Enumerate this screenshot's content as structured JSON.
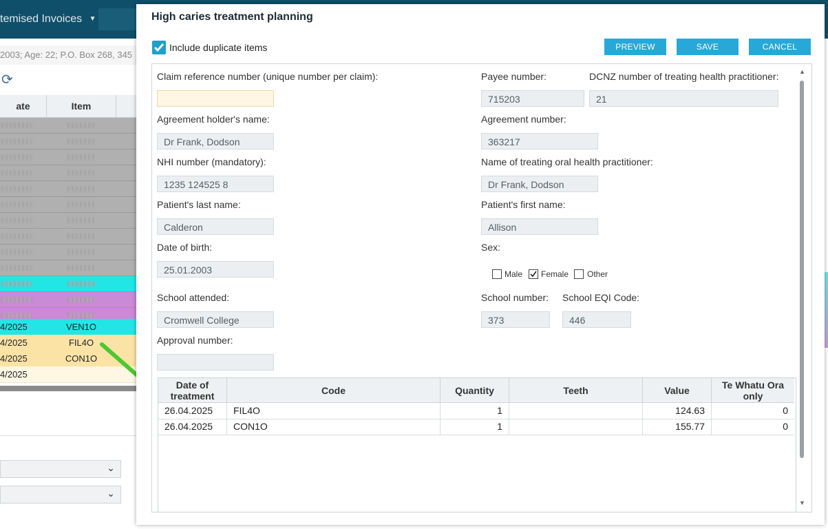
{
  "background": {
    "menu_label": "temised Invoices",
    "patient_info": "2003; Age: 22; P.O. Box 268, 345",
    "table_headers": [
      "ate",
      "Item"
    ],
    "rows": [
      {
        "date": "4/2025",
        "item": "VEN1O",
        "color": "#22e6e6"
      },
      {
        "date": "4/2025",
        "item": "FIL4O",
        "color": "#fbe3a6"
      },
      {
        "date": "4/2025",
        "item": "CON1O",
        "color": "#fbe3a6"
      },
      {
        "date": "4/2025",
        "item": "",
        "color": "#fff7e3"
      }
    ],
    "blurred_row_colors": [
      "#b0b0b0",
      "#b0b0b0",
      "#b0b0b0",
      "#b0b0b0",
      "#b0b0b0",
      "#b0b0b0",
      "#b0b0b0",
      "#b0b0b0",
      "#b0b0b0",
      "#b0b0b0",
      "#22e6e6",
      "#c98ad6",
      "#c98ad6"
    ]
  },
  "dialog": {
    "title": "High caries treatment planning",
    "include_duplicates_label": "Include duplicate items",
    "include_duplicates_checked": true,
    "buttons": {
      "preview": "PREVIEW",
      "save": "SAVE",
      "cancel": "CANCEL"
    },
    "accent_color": "#26a9d8",
    "form": {
      "claim_ref_label": "Claim reference number (unique number per claim):",
      "claim_ref_value": "",
      "payee_label": "Payee number:",
      "payee_value": "715203",
      "dcnz_label": "DCNZ number of treating health practitioner:",
      "dcnz_value": "21",
      "holder_label": "Agreement holder's name:",
      "holder_value": "Dr Frank, Dodson",
      "agreement_label": "Agreement number:",
      "agreement_value": "363217",
      "nhi_label": "NHI number (mandatory):",
      "nhi_value": "1235 124525 8",
      "practitioner_label": "Name of treating oral health practitioner:",
      "practitioner_value": "Dr Frank, Dodson",
      "last_name_label": "Patient's last name:",
      "last_name_value": "Calderon",
      "first_name_label": "Patient's first name:",
      "first_name_value": "Allison",
      "dob_label": "Date of birth:",
      "dob_value": "25.01.2003",
      "sex_label": "Sex:",
      "sex_options": {
        "male": "Male",
        "female": "Female",
        "other": "Other"
      },
      "sex_selected": "Female",
      "school_label": "School attended:",
      "school_value": "Cromwell College",
      "school_number_label": "School number:",
      "school_number_value": "373",
      "eqi_label": "School EQI Code:",
      "eqi_value": "446",
      "approval_label": "Approval number:",
      "approval_value": ""
    },
    "grid": {
      "headers": {
        "date_line1": "Date of",
        "date_line2": "treatment",
        "code": "Code",
        "quantity": "Quantity",
        "teeth": "Teeth",
        "value": "Value",
        "tewhatu_line1": "Te Whatu Ora",
        "tewhatu_line2": "only"
      },
      "rows": [
        {
          "date": "26.04.2025",
          "code": "FIL4O",
          "quantity": "1",
          "teeth": "",
          "value": "124.63",
          "tewhatu": "0"
        },
        {
          "date": "26.04.2025",
          "code": "CON1O",
          "quantity": "1",
          "teeth": "",
          "value": "155.77",
          "tewhatu": "0"
        }
      ]
    }
  }
}
